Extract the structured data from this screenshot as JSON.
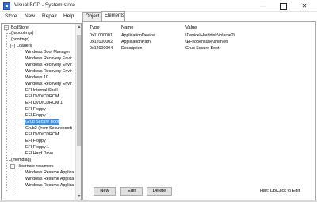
{
  "window": {
    "title": "Visual BCD - System store",
    "controls": {
      "minimize": "—",
      "close": "✕"
    }
  },
  "menu": [
    "Store",
    "New",
    "Repair",
    "Help"
  ],
  "tabs": [
    "Object",
    "Elements"
  ],
  "tree": {
    "root": "BcdStore",
    "items": [
      "{fwbootmgr}",
      "{bootmgr}",
      "Loaders",
      "Windows Boot Manager",
      "Windows Recovery Envir",
      "Windows Recovery Envir",
      "Windows Recovery Envir",
      "Windows 10",
      "Windows Recovery Envir",
      "EFI Internal Shell",
      "EFI DVD/CDROM",
      "EFI DVD/CDROM 1",
      "EFI Floppy",
      "EFI Floppy 1",
      "Grub Secure Boot",
      "Grub2 (from Secureboot)",
      "EFI DVD/CDROM",
      "EFI Floppy",
      "EFI Floppy 1",
      "EFI Hard Drive",
      "{memdiag}",
      "Hibernate resumers",
      "Windows Resume Applica",
      "Windows Resume Applica",
      "Windows Resume Applica"
    ],
    "selected": "Grub Secure Boot"
  },
  "grid": {
    "headers": [
      "Type",
      "Name",
      "Value"
    ],
    "rows": [
      {
        "type": "0x11000001",
        "name": "ApplicationDevice",
        "value": "\\Device\\HarddiskVolume2\\"
      },
      {
        "type": "0x12000002",
        "name": "ApplicationPath",
        "value": "\\EFI\\opensuse\\shim.efi"
      },
      {
        "type": "0x12000004",
        "name": "Description",
        "value": "Grub Secure Boot"
      }
    ]
  },
  "buttons": {
    "new": "New",
    "edit": "Edit",
    "delete": "Delete"
  },
  "hint": "Hint: DblClick to Edit",
  "scroll": {
    "up": "▲",
    "down": "▼"
  },
  "expander_symbol": "−"
}
